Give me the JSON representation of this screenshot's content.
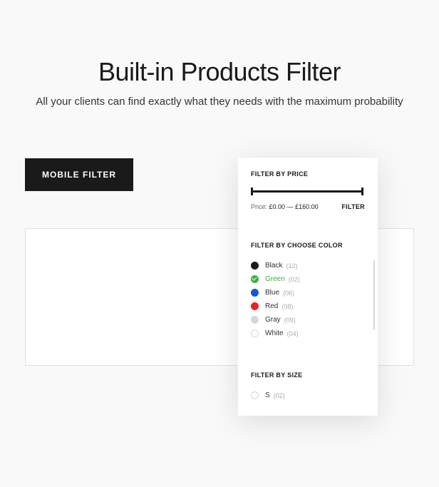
{
  "hero": {
    "title": "Built-in Products Filter",
    "subtitle": "All your clients can find exactly what they needs with the maximum probability"
  },
  "mobile_filter_label": "MOBILE FILTER",
  "filter_panel": {
    "price": {
      "title": "FILTER BY PRICE",
      "label": "Price:",
      "min": "£0.00",
      "sep": "—",
      "max": "£160.00",
      "button": "FILTER"
    },
    "color": {
      "title": "FILTER BY CHOOSE COLOR",
      "items": [
        {
          "name": "Black",
          "count": "(12)",
          "swatch": "black",
          "selected": false
        },
        {
          "name": "Green",
          "count": "(02)",
          "swatch": "green",
          "selected": true
        },
        {
          "name": "Blue",
          "count": "(06)",
          "swatch": "blue",
          "selected": false
        },
        {
          "name": "Red",
          "count": "(08)",
          "swatch": "red",
          "selected": false
        },
        {
          "name": "Gray",
          "count": "(09)",
          "swatch": "gray",
          "selected": false
        },
        {
          "name": "White",
          "count": "(04)",
          "swatch": "white",
          "selected": false
        }
      ]
    },
    "size": {
      "title": "FILTER BY SIZE",
      "items": [
        {
          "name": "S",
          "count": "(02)"
        }
      ]
    }
  }
}
